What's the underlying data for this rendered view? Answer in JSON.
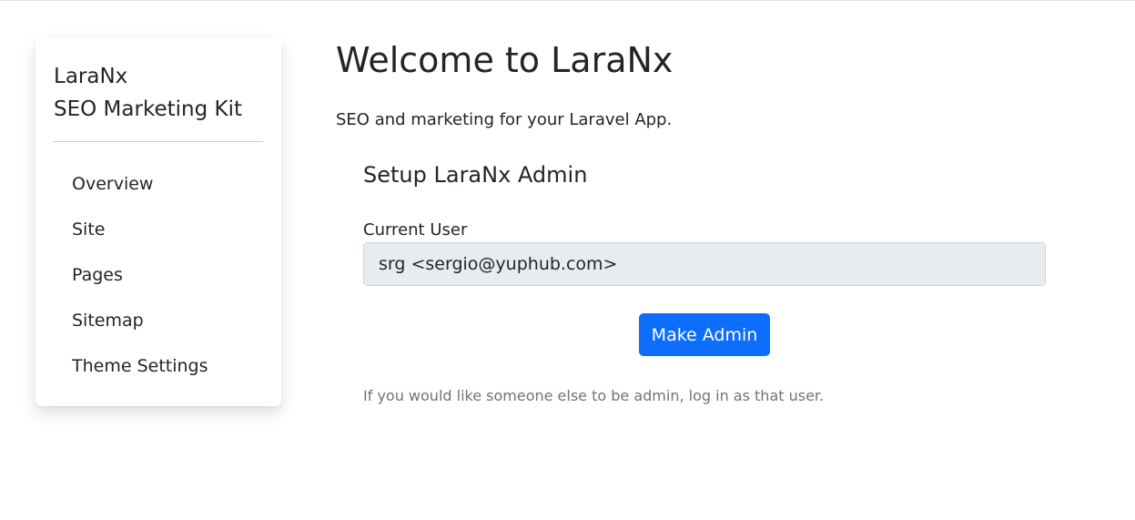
{
  "sidebar": {
    "brand_line1": "LaraNx",
    "brand_line2": "SEO Marketing Kit",
    "items": [
      {
        "label": "Overview"
      },
      {
        "label": "Site"
      },
      {
        "label": "Pages"
      },
      {
        "label": "Sitemap"
      },
      {
        "label": "Theme Settings"
      }
    ]
  },
  "main": {
    "title": "Welcome to LaraNx",
    "subtitle": "SEO and marketing for your Laravel App.",
    "section_title": "Setup LaraNx Admin",
    "current_user_label": "Current User",
    "current_user_value": "srg <sergio@yuphub.com>",
    "make_admin_label": "Make Admin",
    "help_text": "If you would like someone else to be admin, log in as that user."
  },
  "colors": {
    "primary": "#0d6efd",
    "muted_text": "#6c757d",
    "readonly_field_bg": "#e9ecef"
  }
}
